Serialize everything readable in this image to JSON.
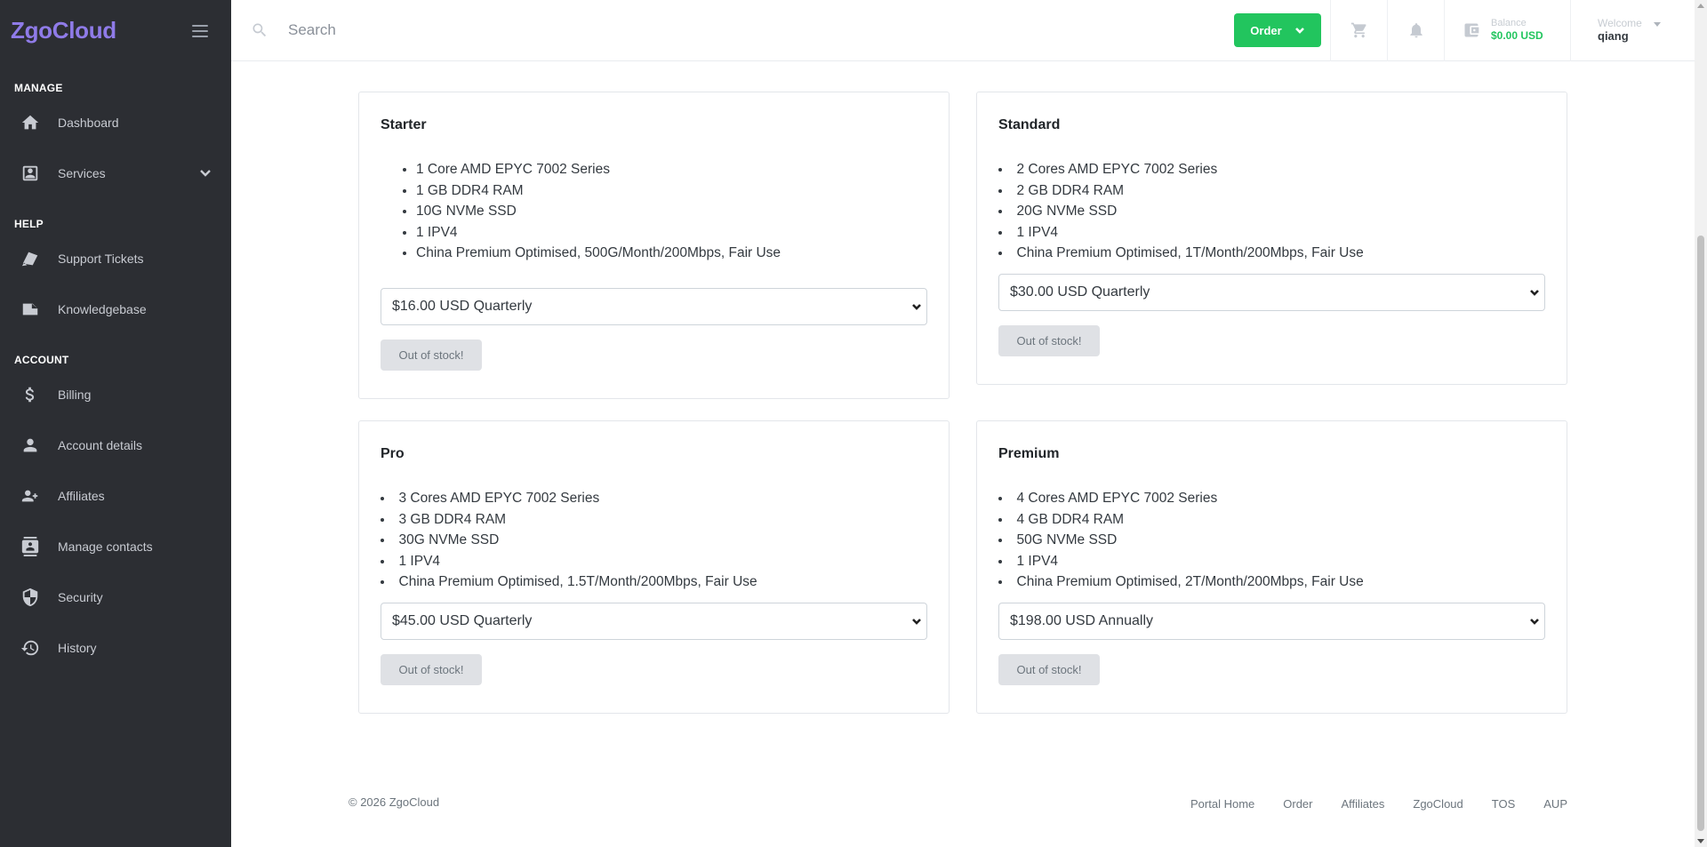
{
  "sidebar": {
    "brand": "ZgoCloud",
    "sections": [
      {
        "label": "MANAGE",
        "items": [
          {
            "label": "Dashboard",
            "icon": "home-icon"
          },
          {
            "label": "Services",
            "icon": "services-icon",
            "expandable": true
          }
        ]
      },
      {
        "label": "HELP",
        "items": [
          {
            "label": "Support Tickets",
            "icon": "tickets-icon"
          },
          {
            "label": "Knowledgebase",
            "icon": "knowledgebase-icon"
          }
        ]
      },
      {
        "label": "ACCOUNT",
        "items": [
          {
            "label": "Billing",
            "icon": "dollar-icon"
          },
          {
            "label": "Account details",
            "icon": "person-icon"
          },
          {
            "label": "Affiliates",
            "icon": "affiliates-icon"
          },
          {
            "label": "Manage contacts",
            "icon": "contacts-icon"
          },
          {
            "label": "Security",
            "icon": "shield-icon"
          },
          {
            "label": "History",
            "icon": "history-icon"
          }
        ]
      }
    ]
  },
  "topbar": {
    "search_placeholder": "Search",
    "order_label": "Order",
    "balance_label": "Balance",
    "balance_value": "$0.00 USD",
    "welcome_label": "Welcome",
    "username": "qiang"
  },
  "products": [
    {
      "name": "Starter",
      "features": [
        "1 Core AMD EPYC 7002 Series",
        "1 GB DDR4 RAM",
        "10G NVMe SSD",
        "1 IPV4",
        "China Premium Optimised, 500G/Month/200Mbps, Fair Use"
      ],
      "price": "$16.00 USD Quarterly",
      "button": "Out of stock!"
    },
    {
      "name": "Standard",
      "features": [
        "2 Cores AMD EPYC 7002 Series",
        "2 GB DDR4 RAM",
        "20G NVMe SSD",
        "1 IPV4",
        "China Premium Optimised, 1T/Month/200Mbps, Fair Use"
      ],
      "price": "$30.00 USD Quarterly",
      "button": "Out of stock!"
    },
    {
      "name": "Pro",
      "features": [
        "3 Cores AMD EPYC 7002 Series",
        "3 GB DDR4 RAM",
        "30G NVMe SSD",
        "1 IPV4",
        "China Premium Optimised, 1.5T/Month/200Mbps, Fair Use"
      ],
      "price": "$45.00 USD Quarterly",
      "button": "Out of stock!"
    },
    {
      "name": "Premium",
      "features": [
        "4 Cores AMD EPYC 7002 Series",
        "4 GB DDR4 RAM",
        "50G NVMe SSD",
        "1 IPV4",
        "China Premium Optimised, 2T/Month/200Mbps, Fair Use"
      ],
      "price": "$198.00 USD Annually",
      "button": "Out of stock!"
    }
  ],
  "footer": {
    "copyright": "© 2026 ZgoCloud",
    "links": [
      "Portal Home",
      "Order",
      "Affiliates",
      "ZgoCloud",
      "TOS",
      "AUP"
    ]
  },
  "colors": {
    "brand": "#8f7be8",
    "sidebar_bg": "#2c2e33",
    "accent_green": "#22c55e"
  }
}
